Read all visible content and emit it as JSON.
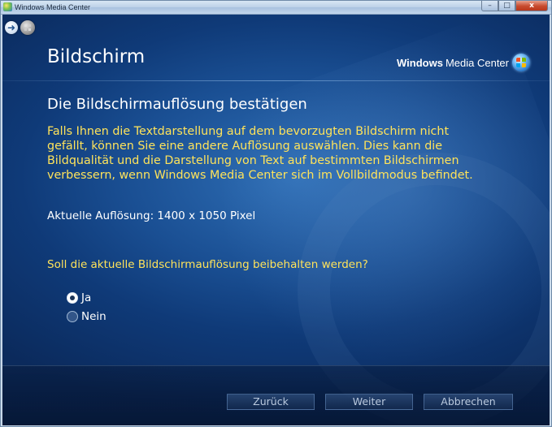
{
  "window": {
    "title": "Windows Media Center",
    "minimize_glyph": "–",
    "maximize_glyph": "□",
    "close_glyph": "x"
  },
  "nav": {
    "back_icon": "back-arrow-icon",
    "back_glyph": "➜",
    "home_icon": "windows-start-orb-icon"
  },
  "header": {
    "section_title": "Bildschirm",
    "brand_bold": "Windows",
    "brand_regular": "Media Center",
    "brand_icon": "windows-media-center-logo-icon"
  },
  "content": {
    "heading": "Die Bildschirmauflösung bestätigen",
    "description_lines": [
      "Falls Ihnen die Textdarstellung auf dem bevorzugten Bildschirm nicht",
      "gefällt, können Sie eine andere Auflösung auswählen. Dies kann die",
      "Bildqualität und die Darstellung von Text auf bestimmten Bildschirmen",
      "verbessern, wenn Windows Media Center sich im Vollbildmodus befindet."
    ],
    "current_resolution": "Aktuelle Auflösung: 1400 x 1050 Pixel",
    "question": "Soll die aktuelle Bildschirmauflösung beibehalten werden?",
    "options": [
      {
        "label": "Ja",
        "selected": true
      },
      {
        "label": "Nein",
        "selected": false
      }
    ]
  },
  "footer": {
    "back_label": "Zurück",
    "next_label": "Weiter",
    "cancel_label": "Abbrechen"
  },
  "colors": {
    "accent_yellow": "#ffe35a",
    "background_blue": "#1a4f93",
    "text_white": "#ffffff"
  }
}
